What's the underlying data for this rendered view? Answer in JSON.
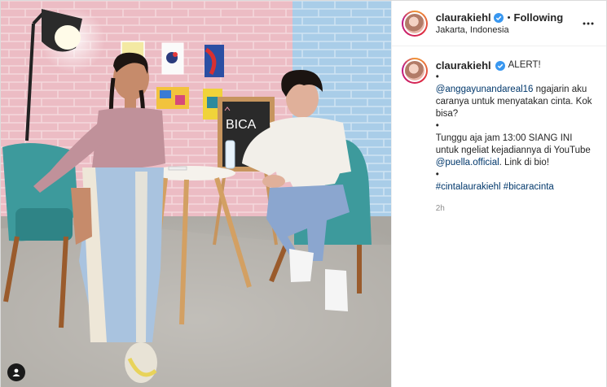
{
  "post": {
    "author": {
      "username": "claurakiehl",
      "verified": true,
      "follow_status": "Following",
      "location": "Jakarta, Indonesia"
    },
    "caption": {
      "headline": "ALERT!",
      "bullet1": "•",
      "mention_user": "@anggayunandareal16",
      "line1_rest": " ngajarin aku caranya untuk menyatakan cinta. Kok bisa?",
      "bullet2": "•",
      "line2_text": "Tunggu aja jam 13:00 SIANG INI untuk ngeliat kejadiannya di YouTube ",
      "mention_channel": "@puella.official",
      "line2_end": ". Link di bio!",
      "bullet3": "•",
      "hashtags": "#cintalaurakiehl #bicaracinta"
    },
    "timestamp": "2h",
    "image": {
      "board_text": "BICA",
      "icons": {
        "user_tag": "user-tag-icon",
        "more": "more-options-icon",
        "verified": "verified-badge-icon"
      }
    }
  },
  "colors": {
    "link": "#00376b",
    "verified": "#3897f0",
    "wall_pink": "#e9b7bf",
    "wall_blue": "#9fc6e3",
    "chair_teal": "#3d9a9c"
  }
}
